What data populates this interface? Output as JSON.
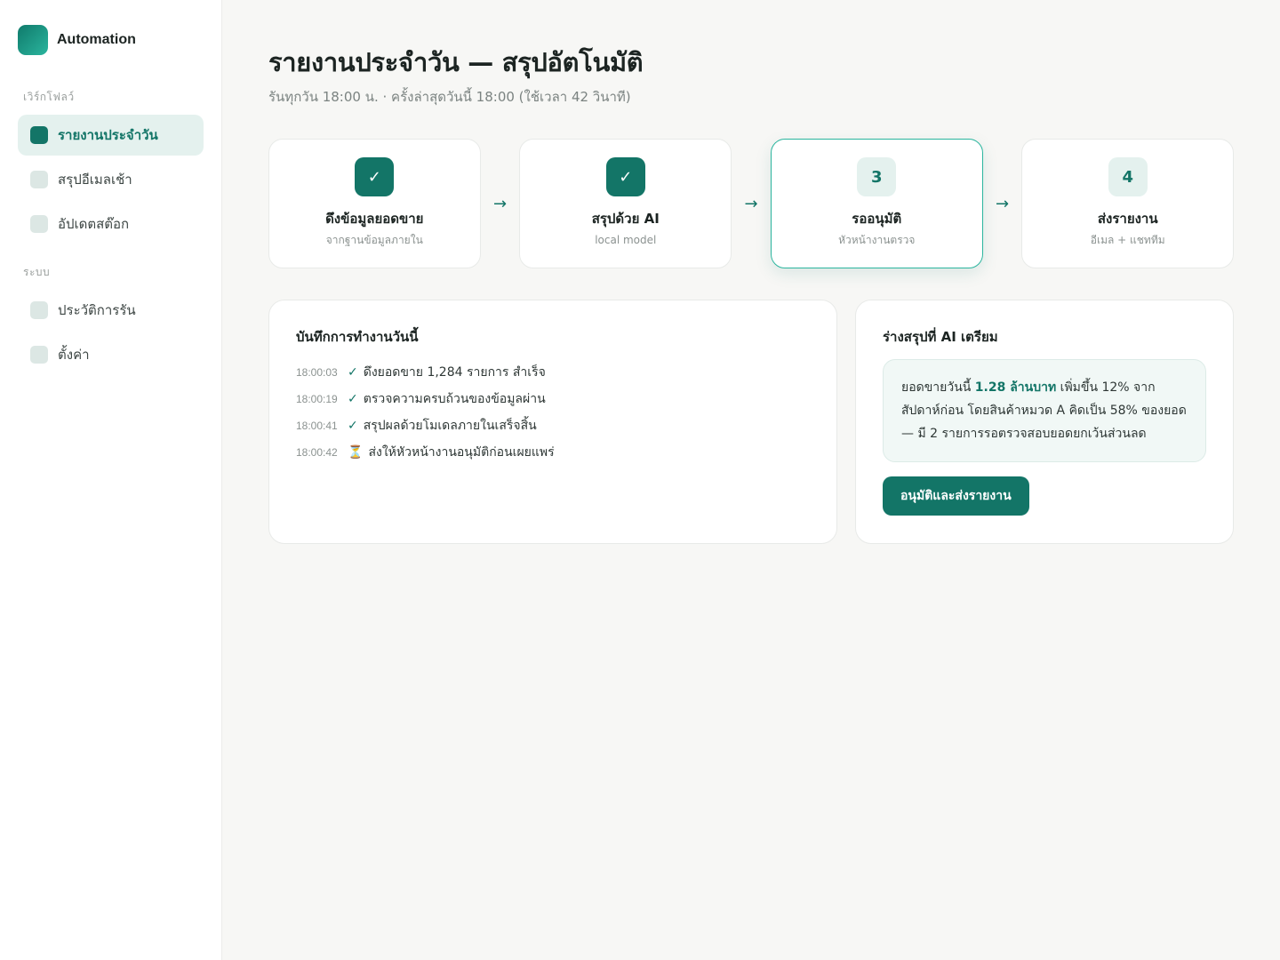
{
  "sidebar": {
    "brand": "Automation",
    "section_workflows": "เวิร์กโฟลว์",
    "section_system": "ระบบ",
    "workflows": [
      {
        "label": "รายงานประจำวัน",
        "active": true
      },
      {
        "label": "สรุปอีเมลเช้า",
        "active": false
      },
      {
        "label": "อัปเดตสต๊อก",
        "active": false
      }
    ],
    "system": [
      {
        "label": "ประวัติการรัน"
      },
      {
        "label": "ตั้งค่า"
      }
    ]
  },
  "header": {
    "title": "รายงานประจำวัน — สรุปอัตโนมัติ",
    "subtitle": "รันทุกวัน 18:00 น. · ครั้งล่าสุดวันนี้ 18:00 (ใช้เวลา 42 วินาที)"
  },
  "steps": [
    {
      "badge": "✓",
      "state": "done",
      "title": "ดึงข้อมูลยอดขาย",
      "subtitle": "จากฐานข้อมูลภายใน"
    },
    {
      "badge": "✓",
      "state": "done",
      "title": "สรุปด้วย AI",
      "subtitle": "local model"
    },
    {
      "badge": "3",
      "state": "current",
      "title": "รออนุมัติ",
      "subtitle": "หัวหน้างานตรวจ"
    },
    {
      "badge": "4",
      "state": "pending",
      "title": "ส่งรายงาน",
      "subtitle": "อีเมล + แชททีม"
    }
  ],
  "step_arrow": "→",
  "log": {
    "title": "บันทึกการทำงานวันนี้",
    "entries": [
      {
        "time": "18:00:03",
        "mark": "✓",
        "text": "ดึงยอดขาย 1,284 รายการ สำเร็จ"
      },
      {
        "time": "18:00:19",
        "mark": "✓",
        "text": "ตรวจความครบถ้วนของข้อมูลผ่าน"
      },
      {
        "time": "18:00:41",
        "mark": "✓",
        "text": "สรุปผลด้วยโมเดลภายในเสร็จสิ้น"
      },
      {
        "time": "18:00:42",
        "mark": "⏳",
        "text": "ส่งให้หัวหน้างานอนุมัติก่อนเผยแพร่"
      }
    ]
  },
  "ai_draft": {
    "title": "ร่างสรุปที่ AI เตรียม",
    "text_before": "ยอดขายวันนี้ ",
    "highlight": "1.28 ล้านบาท",
    "text_after": " เพิ่มขึ้น 12% จากสัปดาห์ก่อน โดยสินค้าหมวด A คิดเป็น 58% ของยอด — มี 2 รายการรอตรวจสอบยอดยกเว้นส่วนลด",
    "button": "อนุมัติและส่งรายงาน"
  },
  "colors": {
    "accent": "#137567",
    "accent_light": "#e4f1ee",
    "background": "#f7f7f5"
  }
}
